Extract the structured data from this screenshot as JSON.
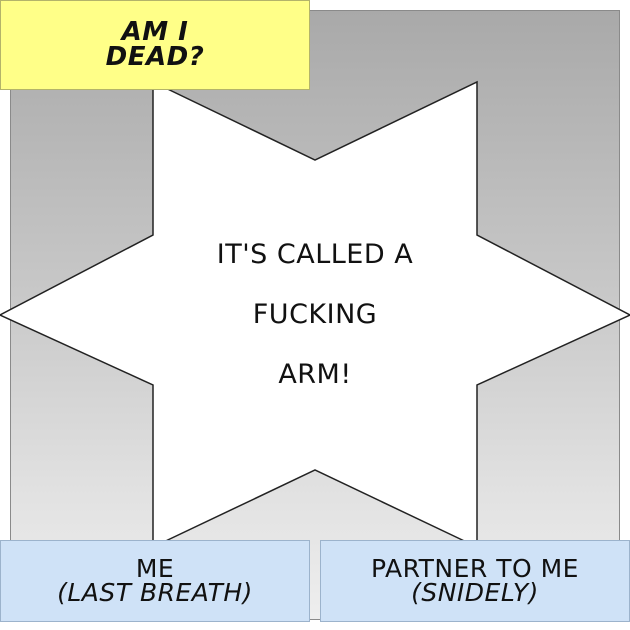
{
  "top_caption": {
    "line1": "AM I",
    "line2": "DEAD?",
    "background": "#ffff88"
  },
  "star": {
    "line1": "IT'S CALLED A",
    "line2": "FUCKING",
    "line3": "ARM!",
    "fill": "#ffffff"
  },
  "bottom_left_caption": {
    "line1": "ME",
    "line2": "(LAST BREATH)",
    "background": "#cfe2f7"
  },
  "bottom_right_caption": {
    "line1": "PARTNER TO ME",
    "line2": "(SNIDELY)",
    "background": "#cfe2f7"
  }
}
